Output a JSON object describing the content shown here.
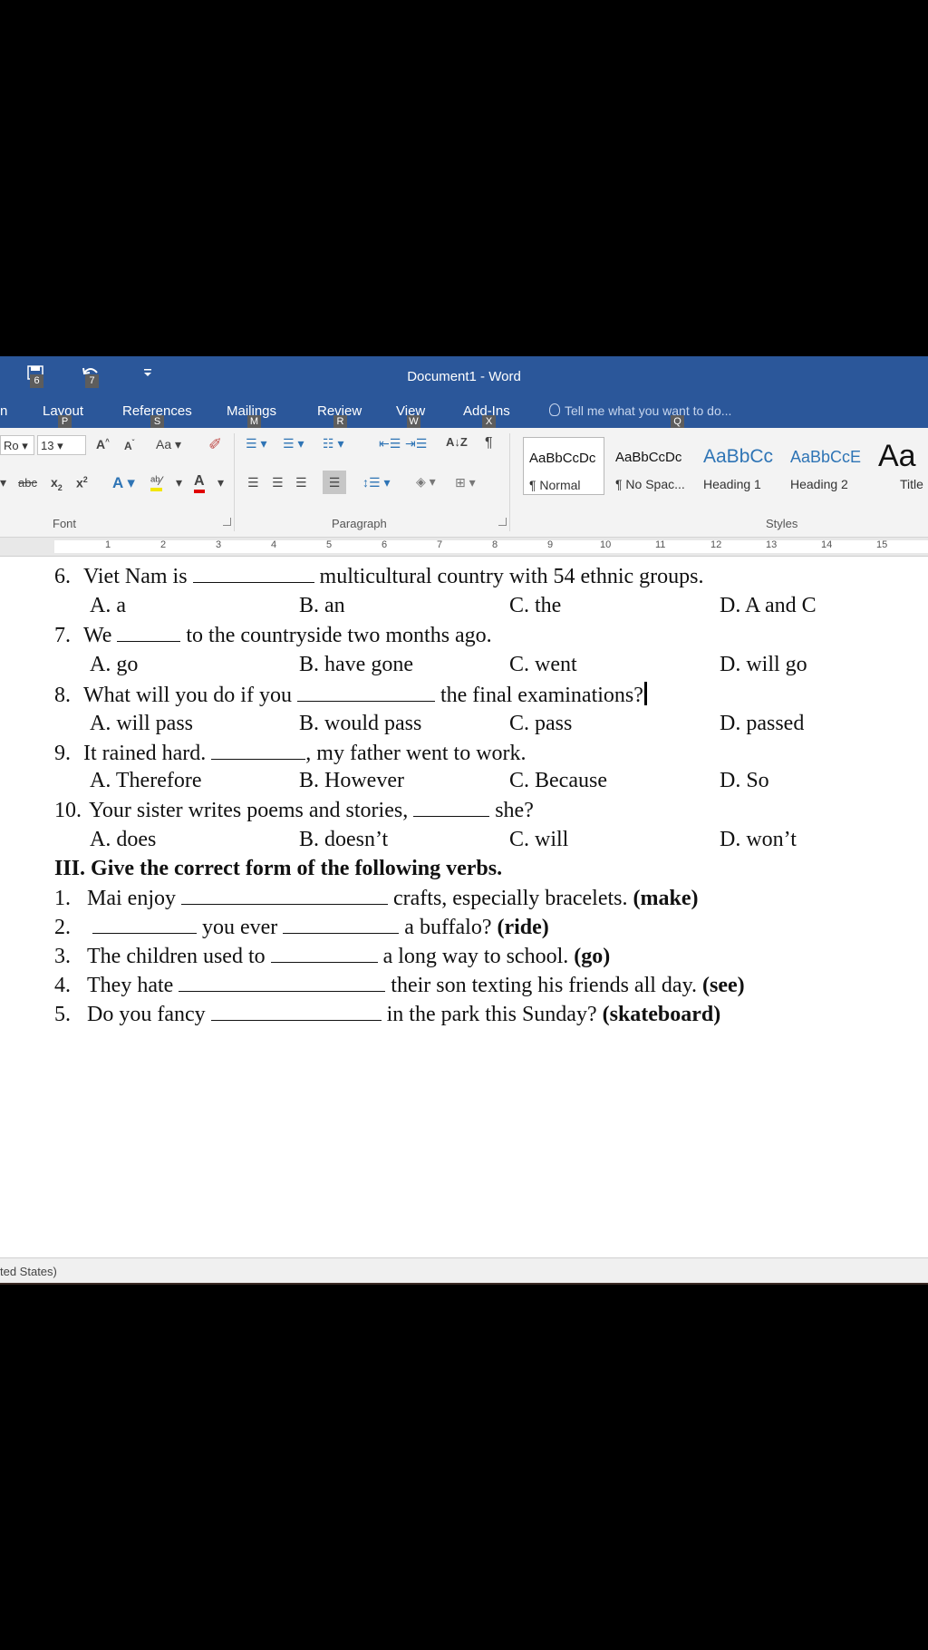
{
  "titlebar": {
    "title": "Document1 - Word",
    "keytips": [
      "6",
      "7"
    ]
  },
  "ribbon_tabs": {
    "tabs": [
      {
        "label": "n",
        "keytip": ""
      },
      {
        "label": "Layout",
        "keytip": "P"
      },
      {
        "label": "References",
        "keytip": "S"
      },
      {
        "label": "Mailings",
        "keytip": "M"
      },
      {
        "label": "Review",
        "keytip": "R"
      },
      {
        "label": "View",
        "keytip": "W"
      },
      {
        "label": "Add-Ins",
        "keytip": "X"
      }
    ],
    "tell_me": "Tell me what you want to do...",
    "tell_me_keytip": "Q"
  },
  "ribbon": {
    "font_name": "Ro",
    "font_size": "13",
    "change_case": "Aa",
    "strike": "abc",
    "font_group": "Font",
    "paragraph_group": "Paragraph",
    "styles_group": "Styles",
    "styles": [
      {
        "sample": "AaBbCcDc",
        "name": "¶ Normal"
      },
      {
        "sample": "AaBbCcDc",
        "name": "¶ No Spac..."
      },
      {
        "sample": "AaBbCc",
        "name": "Heading 1"
      },
      {
        "sample": "AaBbCcE",
        "name": "Heading 2"
      },
      {
        "sample": "Aa",
        "name": "Title"
      }
    ]
  },
  "ruler": {
    "numbers": [
      "1",
      "2",
      "3",
      "4",
      "5",
      "6",
      "7",
      "8",
      "9",
      "10",
      "11",
      "12",
      "13",
      "14",
      "15"
    ]
  },
  "document": {
    "questions": [
      {
        "num": "6.",
        "before": "Viet Nam is",
        "after": "multicultural country with 54 ethnic groups.",
        "options": [
          "A. a",
          "B. an",
          "C. the",
          "D. A and C"
        ]
      },
      {
        "num": "7.",
        "before": "We",
        "after": "to the countryside two months ago.",
        "options": [
          "A. go",
          "B. have gone",
          "C. went",
          "D. will go"
        ]
      },
      {
        "num": "8.",
        "before": "What will you do if you",
        "after": "the final examinations?",
        "options": [
          "A. will pass",
          "B. would pass",
          "C. pass",
          "D. passed"
        ]
      },
      {
        "num": "9.",
        "before": "It rained hard.",
        "after": ", my father went to work.",
        "options": [
          "A. Therefore",
          "B. However",
          "C. Because",
          "D. So"
        ]
      },
      {
        "num": "10.",
        "before": "Your sister writes poems and stories,",
        "after": "she?",
        "options": [
          "A. does",
          "B. doesn’t",
          "C. will",
          "D. won’t"
        ]
      }
    ],
    "section_heading": "III. Give the correct form of the following verbs.",
    "verbs": [
      {
        "num": "1.",
        "a": "Mai enjoy",
        "b": "crafts, especially bracelets.",
        "verb": "(make)"
      },
      {
        "num": "2.",
        "a": "",
        "mid": "you ever",
        "b": "a buffalo?",
        "verb": "(ride)"
      },
      {
        "num": "3.",
        "a": "The children used to",
        "b": "a long way to school.",
        "verb": "(go)"
      },
      {
        "num": "4.",
        "a": "They hate",
        "b": "their son texting his friends all day.",
        "verb": "(see)"
      },
      {
        "num": "5.",
        "a": "Do you fancy",
        "b": "in the park this Sunday?",
        "verb": "(skateboard)"
      }
    ]
  },
  "status": {
    "language": "ted States)"
  },
  "colors": {
    "ribbon_blue": "#2b579a",
    "keytip_gray": "#5d5d5d",
    "heading_blue": "#2e74b5"
  }
}
